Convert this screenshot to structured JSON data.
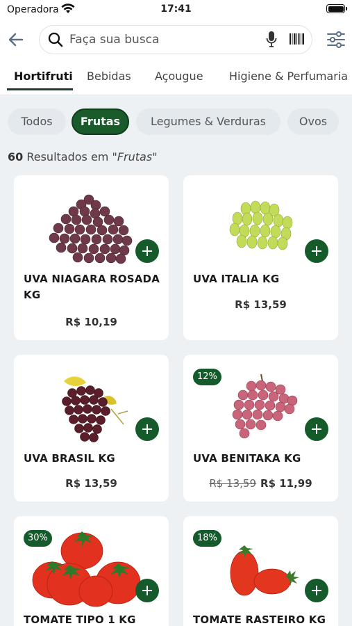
{
  "status_bar": {
    "carrier": "Operadora",
    "time": "17:41"
  },
  "search": {
    "placeholder": "Faça sua busca"
  },
  "categories": [
    "Hortifruti",
    "Bebidas",
    "Açougue",
    "Higiene & Perfumaria"
  ],
  "active_category": "Hortifruti",
  "chips": [
    "Todos",
    "Frutas",
    "Legumes & Verduras",
    "Ovos"
  ],
  "active_chip": "Frutas",
  "results": {
    "count": "60",
    "text": " Resultados em \"",
    "query": "Frutas",
    "close": "\""
  },
  "products": [
    {
      "name": "UVA NIAGARA ROSADA KG",
      "price": "R$ 10,19",
      "old_price": "",
      "discount": "",
      "icon": "red-grape-bunch"
    },
    {
      "name": "UVA ITALIA KG",
      "price": "R$ 13,59",
      "old_price": "",
      "discount": "",
      "icon": "green-grape-bunch"
    },
    {
      "name": "UVA BRASIL KG",
      "price": "R$ 13,59",
      "old_price": "",
      "discount": "",
      "icon": "dark-grape-bunch"
    },
    {
      "name": "UVA BENITAKA KG",
      "price": "R$ 11,99",
      "old_price": "R$ 13,59",
      "discount": "12%",
      "icon": "pink-grape-bunch"
    },
    {
      "name": "TOMATE TIPO 1 KG",
      "price": "",
      "old_price": "",
      "discount": "30%",
      "icon": "tomatoes"
    },
    {
      "name": "TOMATE RASTEIRO KG",
      "price": "",
      "old_price": "",
      "discount": "18%",
      "icon": "plum-tomatoes"
    }
  ],
  "colors": {
    "accent": "#155a2a",
    "background": "#eef1f4"
  }
}
